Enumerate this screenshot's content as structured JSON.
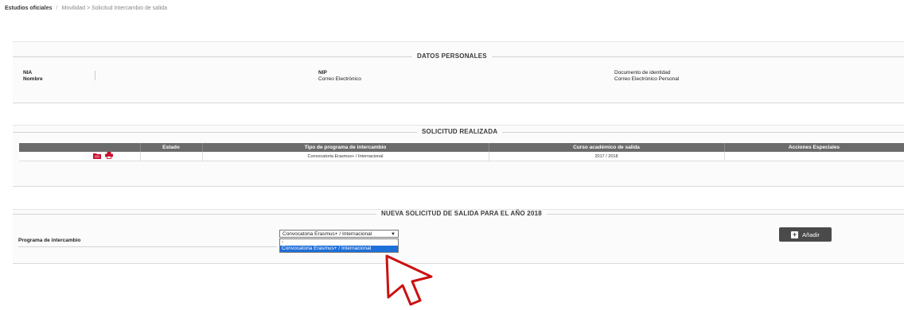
{
  "breadcrumb": {
    "root": "Estudios oficiales",
    "separator": "/",
    "path": "Movilidad > Solicitud Intercambio de salida"
  },
  "personal": {
    "legend": "DATOS PERSONALES",
    "nia_label": "NIA",
    "nombre_label": "Nombre",
    "nip_label": "NIP",
    "correo_label": "Correo Electrónico",
    "documento_label": "Documento de identidad",
    "correo_personal_label": "Correo Electrónico Personal"
  },
  "solicitud": {
    "legend": "SOLICITUD REALIZADA",
    "columns": [
      "",
      "Estado",
      "Tipo de programa de intercambio",
      "Curso académico de salida",
      "Acciones Especiales"
    ],
    "rows": [
      {
        "estado": "",
        "tipo": "Convocatoria Erasmus+ / Internacional",
        "curso": "2017 / 2018",
        "acciones": ""
      }
    ],
    "icon_color": "#c8102e"
  },
  "nueva": {
    "legend": "NUEVA SOLICITUD DE SALIDA PARA EL AÑO 2018",
    "programa_label": "Programa de intercambio",
    "select_value": "Convocatoria Erasmus+ / Internacional",
    "options": [
      "-",
      "Convocatoria Erasmus+ / Internacional"
    ],
    "add_label": "Añadir"
  },
  "colors": {
    "header_bg": "#6b6b6b",
    "button_bg": "#4a4a4a",
    "selection": "#1e6fd9",
    "cursor": "#cc1111"
  }
}
